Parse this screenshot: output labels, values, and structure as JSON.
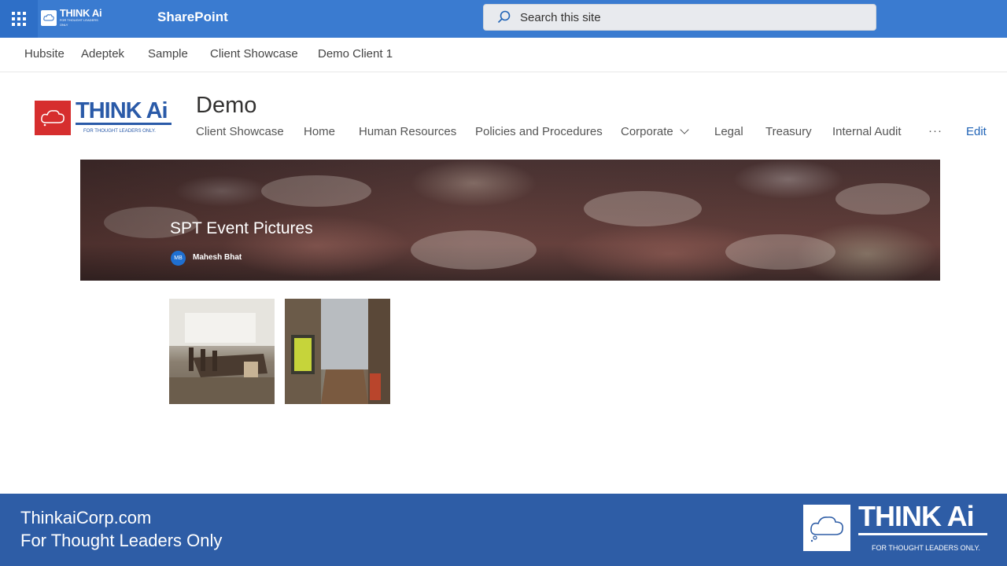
{
  "suite_bar": {
    "app_name": "SharePoint",
    "logo_text": "THINK Ai",
    "logo_tagline": "FOR THOUGHT LEADERS ONLY",
    "search_placeholder": "Search this site"
  },
  "hub_nav": {
    "items": [
      "Hubsite",
      "Adeptek",
      "Sample",
      "Client Showcase",
      "Demo Client 1"
    ]
  },
  "site_header": {
    "logo_word": "THINK Ai",
    "logo_tagline": "FOR THOUGHT LEADERS ONLY.",
    "title": "Demo",
    "nav": [
      "Client Showcase",
      "Home",
      "Human Resources",
      "Policies and Procedures",
      "Corporate",
      "Legal",
      "Treasury",
      "Internal Audit"
    ],
    "more": "···",
    "edit": "Edit"
  },
  "hero": {
    "title": "SPT Event Pictures",
    "author_initials": "MB",
    "author_name": "Mahesh Bhat"
  },
  "gallery": {
    "images": [
      "conference-room-photo",
      "office-hallway-photo"
    ]
  },
  "footer": {
    "line1": "ThinkaiCorp.com",
    "line2": "For Thought Leaders Only",
    "logo_word": "THINK Ai",
    "logo_tagline": "FOR THOUGHT LEADERS ONLY."
  },
  "colors": {
    "suite_bar": "#3a7bd0",
    "footer": "#2e5da6",
    "link": "#1f63b6",
    "logo_red": "#d62e2e"
  }
}
